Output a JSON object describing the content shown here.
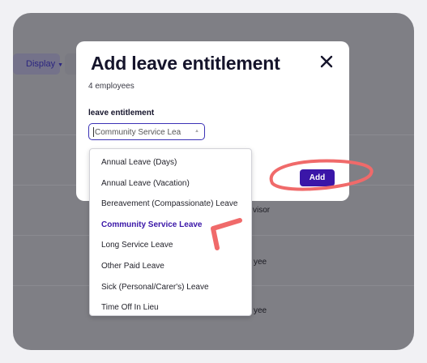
{
  "background": {
    "display_label": "Display",
    "row_texts": [
      "visor",
      "yee",
      "yee"
    ]
  },
  "modal": {
    "title": "Add leave entitlement",
    "subtitle": "4 employees",
    "field_label": "leave entitlement",
    "select_value": "Community Service Lea",
    "add_label": "Add"
  },
  "dropdown": {
    "options": [
      "Annual Leave (Days)",
      "Annual Leave (Vacation)",
      "Bereavement (Compassionate) Leave",
      "Community Service Leave",
      "Long Service Leave",
      "Other Paid Leave",
      "Sick (Personal/Carer's) Leave",
      "Time Off In Lieu"
    ],
    "selected_index": 3
  },
  "colors": {
    "accent": "#3a16a8",
    "annotation": "#f06a6a",
    "overlay": "#7f7f85"
  }
}
